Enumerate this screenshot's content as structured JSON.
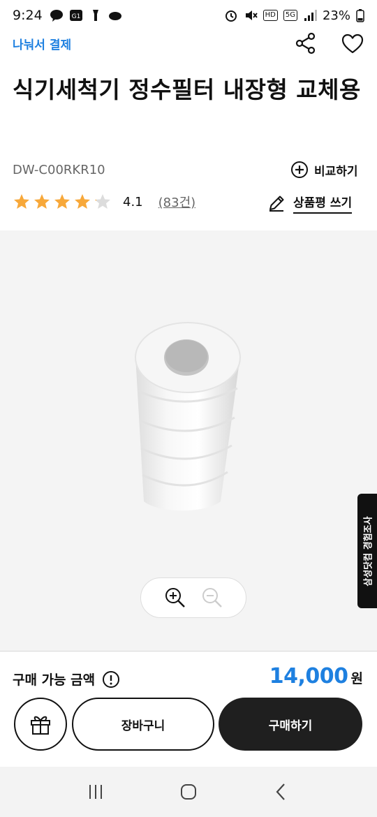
{
  "status_bar": {
    "time": "9:24",
    "battery": "23%",
    "left_icons": [
      "talk-icon",
      "g1-icon",
      "flashlight-icon",
      "cloud-icon"
    ],
    "right_icons": [
      "alarm-icon",
      "mute-icon",
      "hd-icon",
      "5g-icon",
      "signal-icon",
      "battery-icon"
    ],
    "badge_hd": "HD",
    "badge_5g": "5G"
  },
  "header": {
    "pay_link": "나눠서 결제"
  },
  "product": {
    "title": "식기세척기 정수필터 내장형 교체용",
    "model": "DW-C00RKR10",
    "compare_label": "비교하기",
    "rating": "4.1",
    "rating_value": 4.1,
    "rating_max": 5,
    "review_count": "(83건)",
    "write_review_label": "상품평 쓰기"
  },
  "survey_tab": "삼성닷컴 경험조사",
  "purchase": {
    "price_label": "구매 가능 금액",
    "price": "14,000",
    "price_unit": "원",
    "cart_label": "장바구니",
    "buy_label": "구매하기"
  },
  "colors": {
    "accent": "#1e80e0",
    "star": "#f7a83a",
    "dark_button": "#1f1f1f"
  }
}
